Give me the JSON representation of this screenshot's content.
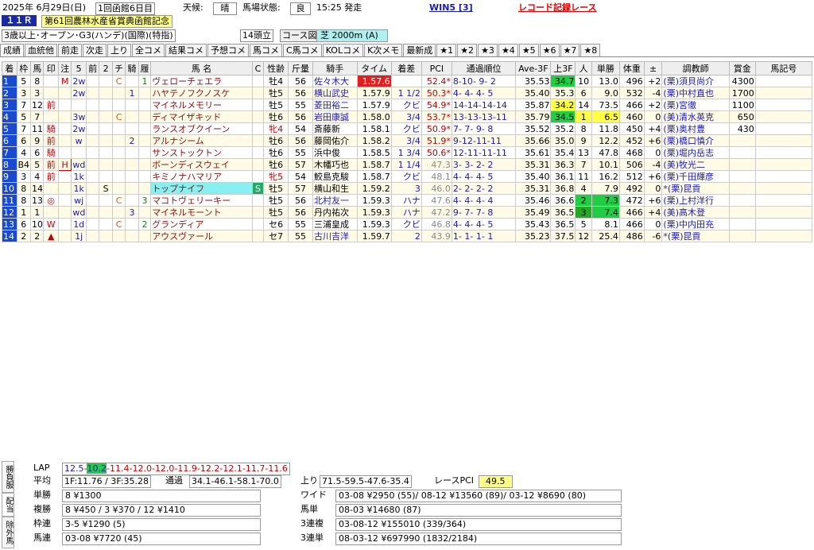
{
  "header": {
    "date": "2025年 6月29日(日)",
    "meeting": "1回函館6日目",
    "weather_label": "天候:",
    "weather": "晴",
    "track_label": "馬場状態:",
    "track": "良",
    "time": "15:25 発走",
    "win5": "WIN5 [3]",
    "record": "レコード記録レース",
    "race_no": "１１Ｒ",
    "race_name": "第61回農林水産省賞典函館記念",
    "conditions": "3歳以上･オープン･G3(ハンデ)(国際)(特指)",
    "runners": "14頭立",
    "course_label": "コース図",
    "course": "芝 2000m (A)"
  },
  "tabs": [
    "成績",
    "血統他",
    "前走",
    "次走",
    "上り",
    "全コメ",
    "結果コメ",
    "予想コメ",
    "馬コメ",
    "C馬コメ",
    "KOLコメ",
    "K次メモ",
    "最新成",
    "★1",
    "★2",
    "★3",
    "★4",
    "★5",
    "★6",
    "★7",
    "★8"
  ],
  "columns": [
    "着",
    "枠",
    "馬",
    "印",
    "注",
    "5",
    "前",
    "2",
    "チ",
    "騎",
    "履",
    "馬 名",
    "C",
    "性齢",
    "斤量",
    "騎手",
    "タイム",
    "着差",
    "PCI",
    "通過順位",
    "Ave-3F",
    "上3F",
    "人",
    "単勝",
    "体重",
    "±",
    "調教師",
    "賞金",
    "馬記号"
  ],
  "colors": {
    "first_time": "#e02020",
    "fast3f": "#22cc44",
    "slow3f": "#ffff44",
    "fav": "#22cc44",
    "row_alt": "#fffbe6"
  },
  "rows": [
    [
      "1",
      "5",
      "8",
      "",
      "M",
      "2w",
      "",
      "",
      "C",
      "",
      "1",
      "ヴェローチェエラ",
      "",
      "牡4",
      "56",
      "佐々木大",
      "1.57.6",
      "",
      "52.4*",
      "8-10- 9- 2",
      "35.53",
      "34.7",
      "10",
      "13.0",
      "496",
      "+2",
      "(栗)須貝尚介",
      "4300",
      ""
    ],
    [
      "2",
      "3",
      "3",
      "",
      "",
      "2w",
      "",
      "",
      "",
      "1",
      "",
      "ハヤテノフクノスケ",
      "",
      "牡5",
      "56",
      "横山武史",
      "1.57.9",
      "1 1/2",
      "50.3*",
      "4- 4- 4- 5",
      "35.40",
      "35.3",
      "6",
      "9.0",
      "532",
      "-4",
      "(栗)中村直也",
      "1700",
      ""
    ],
    [
      "3",
      "7",
      "12",
      "前",
      "",
      "",
      "",
      "",
      "",
      "",
      "",
      "マイネルメモリー",
      "",
      "牡5",
      "55",
      "菱田裕二",
      "1.57.9",
      "クビ",
      "54.9*",
      "14-14-14-14",
      "35.87",
      "34.2",
      "14",
      "73.5",
      "466",
      "+2",
      "(栗)宮徹",
      "1100",
      ""
    ],
    [
      "4",
      "5",
      "7",
      "",
      "",
      "3w",
      "",
      "",
      "C",
      "",
      "",
      "ディマイザキッド",
      "",
      "牡6",
      "56",
      "岩田康誠",
      "1.58.0",
      "3/4",
      "53.7*",
      "13-13-13-11",
      "35.79",
      "34.5",
      "1",
      "6.5",
      "460",
      "0",
      "(美)清水英克",
      "650",
      ""
    ],
    [
      "5",
      "7",
      "11",
      "騎",
      "",
      "2w",
      "",
      "",
      "",
      "",
      "",
      "ランスオブクイーン",
      "",
      "牝4",
      "54",
      "斎藤新",
      "1.58.1",
      "クビ",
      "50.9*",
      "7- 7- 9- 8",
      "35.52",
      "35.2",
      "8",
      "11.8",
      "450",
      "+4",
      "(栗)奥村豊",
      "430",
      ""
    ],
    [
      "6",
      "6",
      "9",
      "前",
      "",
      "w",
      "",
      "",
      "",
      "2",
      "",
      "アルナシーム",
      "",
      "牡6",
      "56",
      "藤岡佑介",
      "1.58.2",
      "3/4",
      "51.9*",
      "9-12-11-11",
      "35.66",
      "35.0",
      "9",
      "12.2",
      "452",
      "+6",
      "(栗)橋口慎介",
      "",
      ""
    ],
    [
      "7",
      "4",
      "6",
      "騎",
      "",
      "",
      "",
      "",
      "",
      "",
      "",
      "サンストックトン",
      "",
      "牡6",
      "55",
      "浜中俊",
      "1.58.5",
      "1 3/4",
      "50.6*",
      "12-11-11-11",
      "35.61",
      "35.4",
      "13",
      "47.8",
      "468",
      "0",
      "(栗)堀内岳志",
      "",
      ""
    ],
    [
      "8",
      "B4",
      "5",
      "前",
      "H",
      "wd",
      "",
      "",
      "",
      "",
      "",
      "ボーンディスウェイ",
      "",
      "牡6",
      "57",
      "木幡巧也",
      "1.58.7",
      "1 1/4",
      "47.3",
      "3- 3- 2- 2",
      "35.31",
      "36.3",
      "7",
      "10.1",
      "506",
      "-4",
      "(美)牧光二",
      "",
      ""
    ],
    [
      "9",
      "3",
      "4",
      "前",
      "",
      "1k",
      "",
      "",
      "",
      "",
      "",
      "キミノナハマリア",
      "",
      "牝5",
      "54",
      "鮫島克駿",
      "1.58.7",
      "クビ",
      "48.1",
      "4- 4- 4- 5",
      "35.40",
      "36.1",
      "11",
      "16.2",
      "512",
      "+6",
      "(栗)千田輝彦",
      "",
      ""
    ],
    [
      "10",
      "8",
      "14",
      "",
      "",
      "1k",
      "",
      "S",
      "",
      "",
      "",
      "トップナイフ",
      "S",
      "牡5",
      "57",
      "横山和生",
      "1.59.2",
      "3",
      "46.0",
      "2- 2- 2- 2",
      "35.31",
      "36.8",
      "4",
      "7.9",
      "492",
      "0",
      "*(栗)昆貢",
      "",
      ""
    ],
    [
      "11",
      "8",
      "13",
      "◎",
      "",
      "wj",
      "",
      "",
      "C",
      "",
      "3",
      "マコトヴェリーキー",
      "",
      "牡5",
      "56",
      "北村友一",
      "1.59.3",
      "ハナ",
      "47.6",
      "4- 4- 4- 4",
      "35.46",
      "36.6",
      "2",
      "7.3",
      "472",
      "+6",
      "(栗)上村洋行",
      "",
      ""
    ],
    [
      "12",
      "1",
      "1",
      "",
      "",
      "wd",
      "",
      "",
      "",
      "3",
      "",
      "マイネルモーント",
      "",
      "牡5",
      "56",
      "丹内祐次",
      "1.59.3",
      "ハナ",
      "47.2",
      "9- 7- 7- 8",
      "35.49",
      "36.5",
      "3",
      "7.4",
      "466",
      "+4",
      "(美)高木登",
      "",
      ""
    ],
    [
      "13",
      "6",
      "10",
      "W",
      "",
      "1d",
      "",
      "",
      "C",
      "",
      "2",
      "グランディア",
      "",
      "セ6",
      "55",
      "三浦皇成",
      "1.59.3",
      "クビ",
      "46.8",
      "4- 4- 4- 5",
      "35.43",
      "36.5",
      "5",
      "8.1",
      "466",
      "0",
      "(栗)中内田充",
      "",
      ""
    ],
    [
      "14",
      "2",
      "2",
      "▲",
      "",
      "1j",
      "",
      "",
      "",
      "",
      "",
      "アウスヴァール",
      "",
      "セ7",
      "55",
      "古川吉洋",
      "1.59.7",
      "2",
      "43.9",
      "1- 1- 1- 1",
      "35.23",
      "37.5",
      "12",
      "25.4",
      "486",
      "-6",
      "*(栗)昆貢",
      "",
      ""
    ]
  ],
  "bottom": {
    "side_tabs": [
      "勝負服",
      "配当",
      "除外馬"
    ],
    "lap_label": "LAP",
    "lap": [
      "12.5",
      "10.2",
      "11.4",
      "12.0",
      "12.0",
      "11.9",
      "12.2",
      "12.1",
      "11.7",
      "11.6"
    ],
    "avg_label": "平均",
    "avg": "1F:11.76 / 3F:35.28",
    "pass_label": "通過",
    "pass": "34.1-46.1-58.1-70.0",
    "agari_label": "上り",
    "agari": "71.5-59.5-47.6-35.4",
    "pci_label": "レースPCI",
    "pci": "49.5",
    "payouts_left": [
      [
        "単勝",
        "8 ¥1300"
      ],
      [
        "複勝",
        "8 ¥450 / 3 ¥370 / 12 ¥1410"
      ],
      [
        "枠連",
        "3-5 ¥1290 (5)"
      ],
      [
        "馬連",
        "03-08 ¥7720 (45)"
      ]
    ],
    "payouts_right": [
      [
        "ワイド",
        "03-08 ¥2950 (55)/ 08-12 ¥13560 (89)/ 03-12 ¥8690 (80)"
      ],
      [
        "馬単",
        "08-03 ¥14680 (87)"
      ],
      [
        "3連複",
        "03-08-12 ¥155010 (339/364)"
      ],
      [
        "3連単",
        "08-03-12 ¥697990 (1832/2184)"
      ]
    ]
  }
}
